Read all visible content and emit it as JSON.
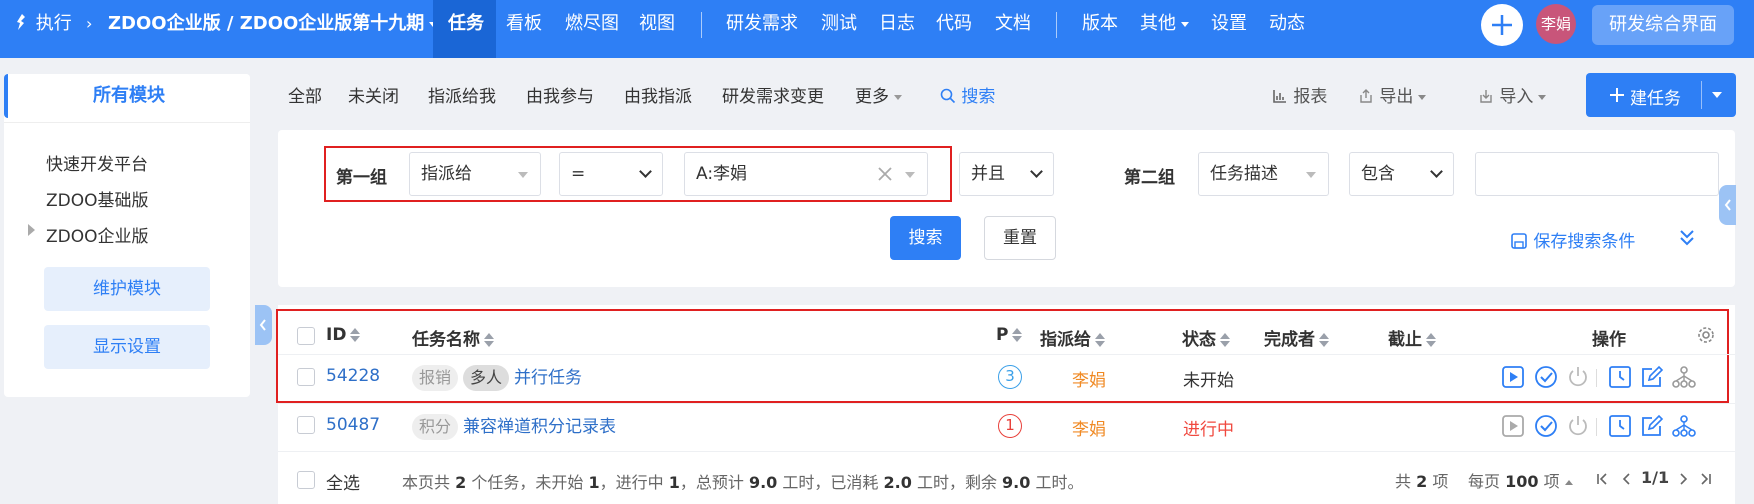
{
  "header": {
    "execute_label": "执行",
    "project_path": "ZDOO企业版 / ZDOO企业版第十九期",
    "nav_items": [
      "任务",
      "看板",
      "燃尽图",
      "视图",
      "研发需求",
      "测试",
      "日志",
      "代码",
      "文档",
      "版本",
      "其他",
      "设置",
      "动态"
    ],
    "active_nav": "任务",
    "user_avatar": "李娟",
    "workspace_button": "研发综合界面",
    "brand_color": "#2e7ff5"
  },
  "sidebar": {
    "title": "所有模块",
    "modules": [
      "快速开发平台",
      "ZDOO基础版",
      "ZDOO企业版"
    ],
    "maintain_button": "维护模块",
    "display_settings_button": "显示设置"
  },
  "filters": {
    "tabs": [
      "全部",
      "未关闭",
      "指派给我",
      "由我参与",
      "由我指派",
      "研发需求变更",
      "更多"
    ],
    "search_label": "搜索",
    "report_label": "报表",
    "export_label": "导出",
    "import_label": "导入",
    "create_task_label": "建任务"
  },
  "search_form": {
    "group1_label": "第一组",
    "group1_field": "指派给",
    "group1_operator": "=",
    "group1_value": "A:李娟",
    "logic": "并且",
    "group2_label": "第二组",
    "group2_field": "任务描述",
    "group2_operator": "包含",
    "group2_value": "",
    "search_button": "搜索",
    "reset_button": "重置",
    "save_condition": "保存搜索条件"
  },
  "table": {
    "columns": [
      "ID",
      "任务名称",
      "P",
      "指派给",
      "状态",
      "完成者",
      "截止",
      "操作"
    ],
    "rows": [
      {
        "id": "54228",
        "tags": [
          "报销",
          "多人"
        ],
        "name": "并行任务",
        "priority": "3",
        "assigned": "李娟",
        "status": "未开始",
        "finisher": "",
        "deadline": ""
      },
      {
        "id": "50487",
        "tags": [
          "积分"
        ],
        "name": "兼容禅道积分记录表",
        "priority": "1",
        "assigned": "李娟",
        "status": "进行中",
        "finisher": "",
        "deadline": ""
      }
    ],
    "footer": {
      "select_all": "全选",
      "summary_pre": "本页共",
      "summary_total": "2",
      "summary_a": "个任务，未开始",
      "summary_not_started": "1",
      "summary_b": "，进行中",
      "summary_in_progress": "1",
      "summary_c": "，总预计",
      "summary_estimate": "9.0",
      "summary_d": "工时，已消耗",
      "summary_consumed": "2.0",
      "summary_e": "工时，剩余",
      "summary_left": "9.0",
      "summary_f": "工时。",
      "total_pre": "共",
      "total_count": "2",
      "total_post": "项",
      "per_page_pre": "每页",
      "per_page": "100",
      "per_page_post": "项",
      "page": "1/1"
    }
  },
  "colors": {
    "primary": "#2e7ff5",
    "highlight_border": "#e02020",
    "link": "#2e6fc8",
    "assignee": "#f08a24",
    "status_in_progress": "#f0483e",
    "priority_3": "#3ba0e8",
    "priority_1": "#e8403a"
  }
}
